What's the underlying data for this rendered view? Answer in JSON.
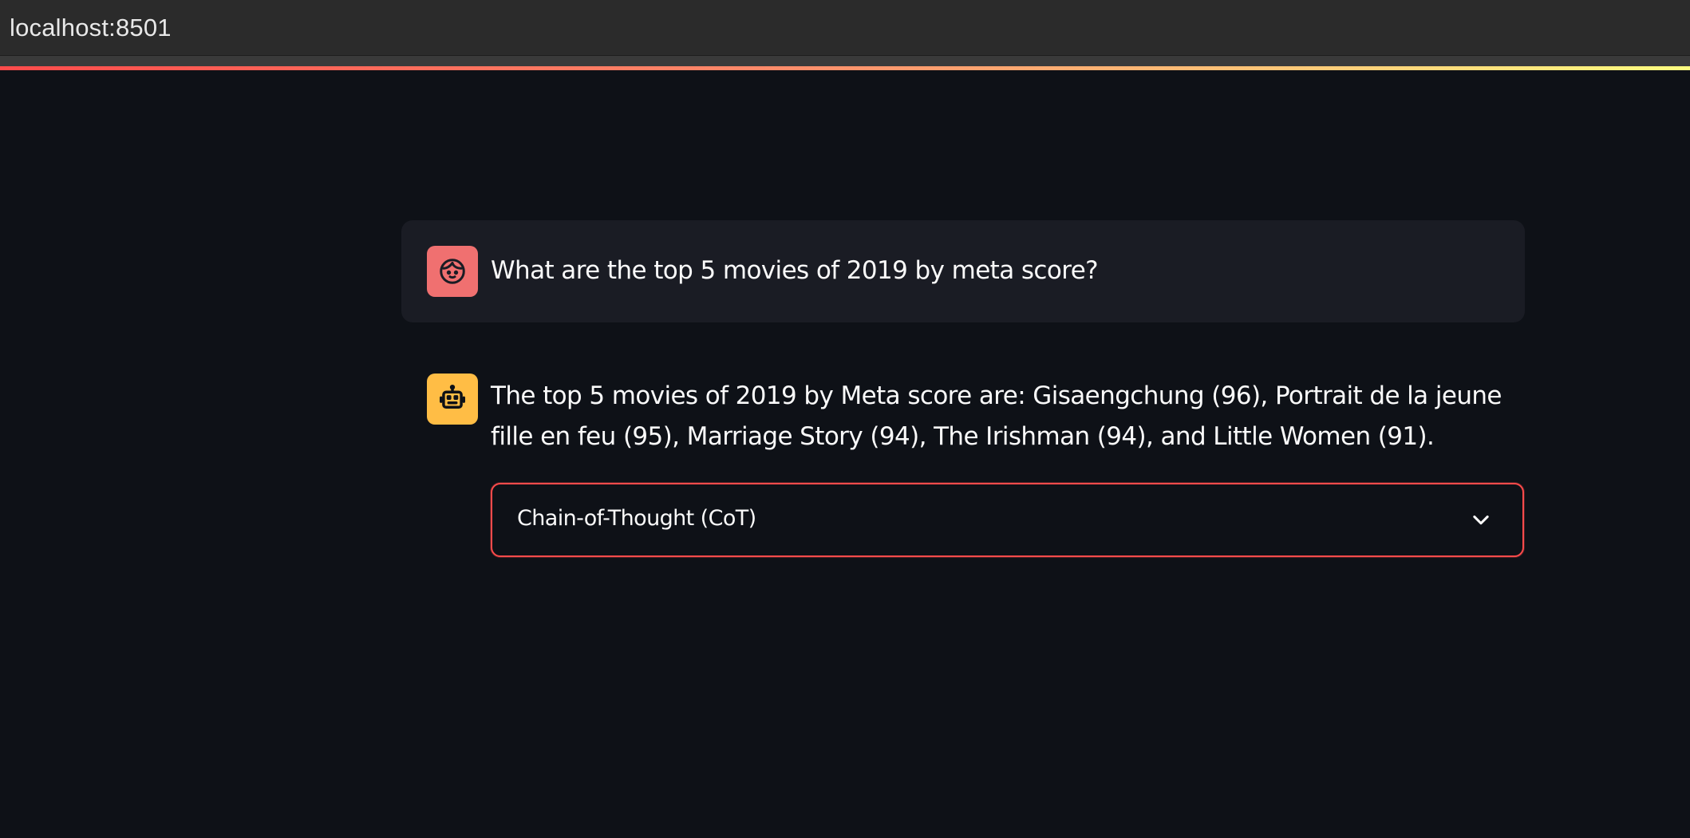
{
  "browser": {
    "url": "localhost:8501"
  },
  "theme": {
    "background": "#0e1117",
    "user_avatar_color": "#f07070",
    "assistant_avatar_color": "#ffbd45",
    "accent": "#ff4b4b"
  },
  "chat": {
    "user_message": {
      "avatar_icon": "user-face-icon",
      "text": "What are the top 5 movies of 2019 by meta score?"
    },
    "assistant_message": {
      "avatar_icon": "robot-icon",
      "text": "The top 5 movies of 2019 by Meta score are: Gisaengchung (96), Portrait de la jeune fille en feu (95), Marriage Story (94), The Irishman (94), and Little Women (91).",
      "expander": {
        "label": "Chain-of-Thought (CoT)",
        "icon": "chevron-down-icon"
      }
    }
  }
}
